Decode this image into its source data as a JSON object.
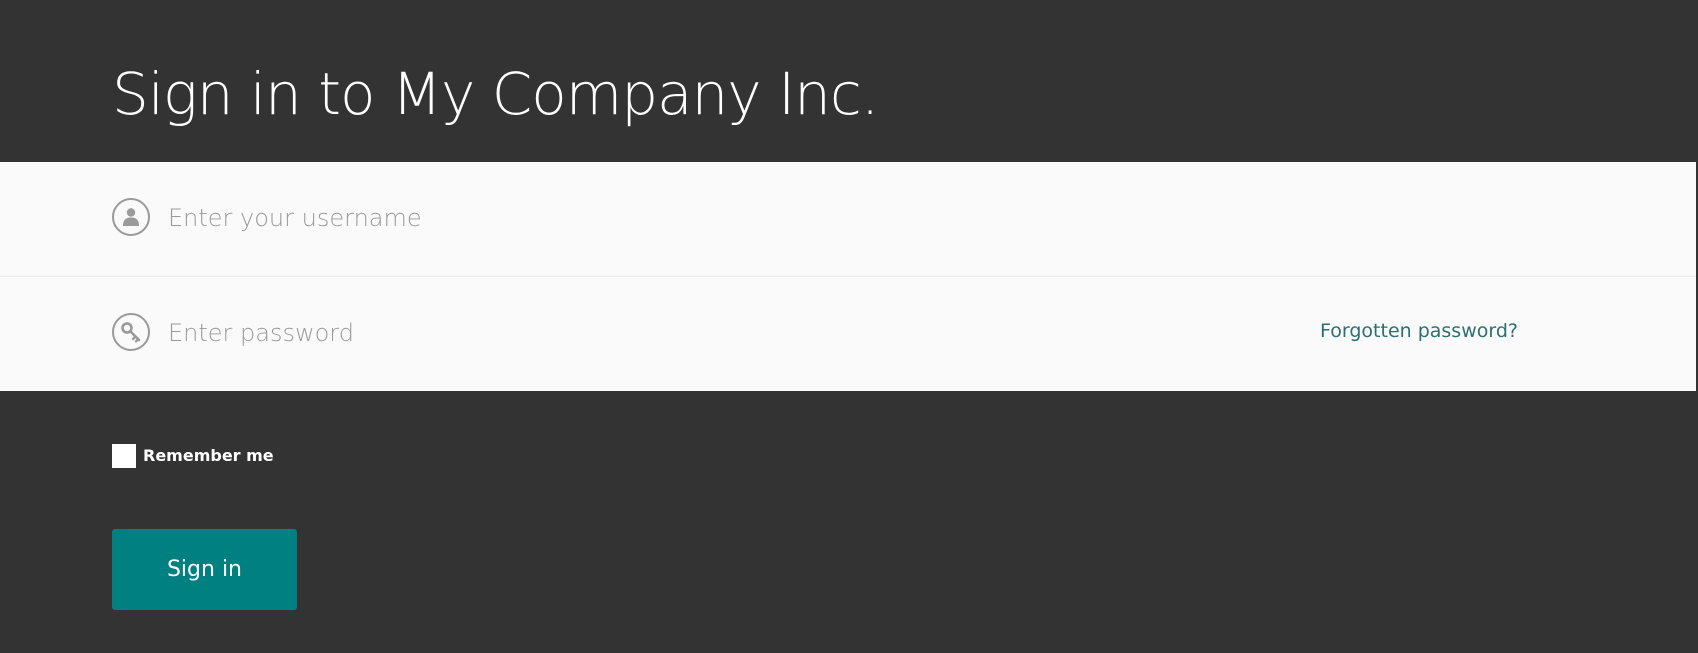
{
  "page": {
    "title": "Sign in to My Company Inc."
  },
  "form": {
    "username": {
      "placeholder": "Enter your username",
      "value": "",
      "icon": "user-icon"
    },
    "password": {
      "placeholder": "Enter password",
      "value": "",
      "icon": "key-icon"
    },
    "forgot_label": "Forgotten password?",
    "remember_label": "Remember me",
    "remember_checked": false,
    "submit_label": "Sign in"
  },
  "colors": {
    "background": "#333333",
    "panel": "#fafafa",
    "accent": "#008080",
    "link": "#2c6f73",
    "icon": "#9a9a9a"
  }
}
